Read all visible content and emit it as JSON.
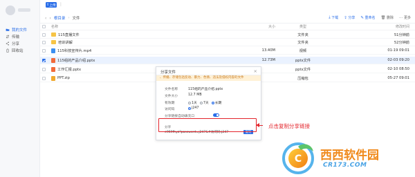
{
  "header": {
    "upload_label": "上传",
    "more_label": "⋮"
  },
  "sidebar": {
    "items": [
      {
        "label": "我的文件",
        "icon": "folder-icon",
        "active": true
      },
      {
        "label": "传输",
        "icon": "transfer-icon",
        "active": false
      },
      {
        "label": "分享",
        "icon": "share-icon",
        "active": false
      },
      {
        "label": "回收站",
        "icon": "trash-icon",
        "active": false
      }
    ]
  },
  "breadcrumb": {
    "back": "‹",
    "forward": "›",
    "root": "根目录",
    "separator": "›",
    "current": "文件"
  },
  "toolbar": {
    "download": "下载",
    "share": "分享",
    "rename": "重命名",
    "delete": "删除",
    "more": "更多"
  },
  "table": {
    "headers": {
      "name": "名称",
      "size": "大小",
      "type": "类型",
      "time": "修改时间"
    },
    "rows": [
      {
        "name": "115直播文件",
        "kind": "folder",
        "size": "",
        "type": "文件夹",
        "time": "51分钟前",
        "selected": false
      },
      {
        "name": "培训讲解",
        "kind": "folder",
        "size": "",
        "type": "文件夹",
        "time": "52分钟前",
        "selected": false
      },
      {
        "name": "115科技宣传片.mp4",
        "kind": "video",
        "size": "13.40M",
        "type": "视频",
        "time": "01-19 09:01",
        "selected": false
      },
      {
        "name": "115组的产品介绍.pptx",
        "kind": "ppt",
        "size": "12.73M",
        "type": "pptx文件",
        "time": "02-03 09:20",
        "selected": true
      },
      {
        "name": "工作汇报.pptx",
        "kind": "ppt",
        "size": "",
        "type": "pptx文件",
        "time": "02-10 08:50",
        "selected": false
      },
      {
        "name": "PPT.zip",
        "kind": "zip",
        "size": "",
        "type": "压缩包",
        "time": "05-27 09:01",
        "selected": false
      }
    ]
  },
  "dialog": {
    "title": "分享文件",
    "close": "×",
    "warning": "、传播、存储包括反动、暴力、色情、违法及侵权内容的文件",
    "file_name_label": "文件名称",
    "file_name": "115组的产品介绍.pptx",
    "file_size_label": "文件大小",
    "file_size": "12.7 MB",
    "validity_label": "有效期",
    "validity_options": [
      "1天",
      "7天",
      "长期"
    ],
    "validity_selected": "长期",
    "code_label": "访问码",
    "code": "j247",
    "autofill_label": "分享链接自动填充口",
    "autofill_on": true,
    "link_label": "分享",
    "link": "e969fhyz?password=j247&#访问码:j247",
    "copy_label": "复制"
  },
  "annotation": {
    "callout": "点击复制分享链接",
    "color": "#e3242b"
  },
  "watermark": {
    "title": "西西软件园",
    "sub": "CR173.COM"
  }
}
